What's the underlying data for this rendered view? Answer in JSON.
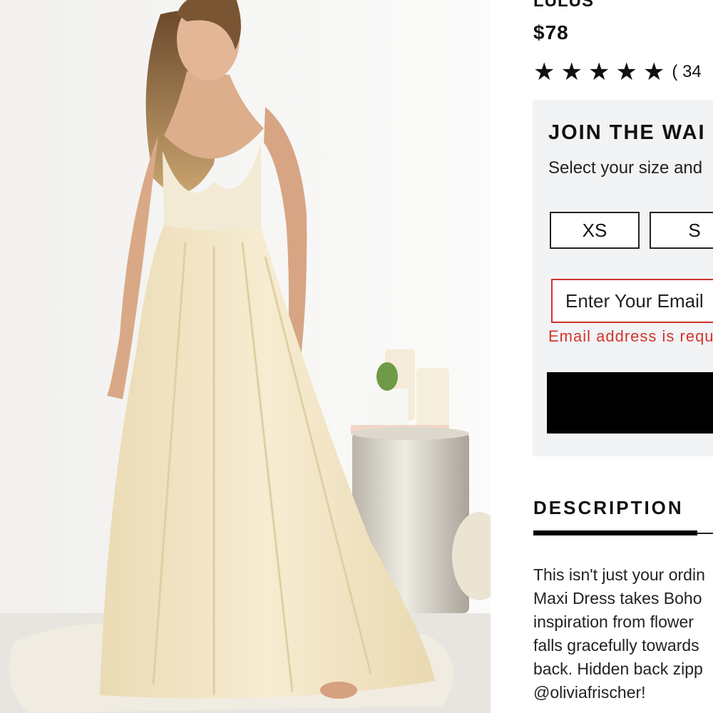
{
  "brand": "LULUS",
  "price": "$78",
  "rating": {
    "stars": 5,
    "star_glyph": "★",
    "review_count_text": "( 34"
  },
  "waitlist": {
    "title": "JOIN THE WAI",
    "subtitle": "Select your size and",
    "sizes": [
      "XS",
      "S"
    ],
    "email_placeholder": "Enter Your Email",
    "error_text": "Email address is requ",
    "submit_color": "#000000"
  },
  "description": {
    "heading": "DESCRIPTION",
    "lines": [
      "This isn't just your ordin",
      "Maxi Dress takes Boho",
      "inspiration from flower",
      "falls gracefully towards",
      "back. Hidden back zipp",
      "@oliviafrischer!"
    ]
  },
  "colors": {
    "error": "#d0352b",
    "panel_bg": "#f2f3f5",
    "dress": "#f3e6c4"
  },
  "icons": {
    "star": "star-icon"
  }
}
